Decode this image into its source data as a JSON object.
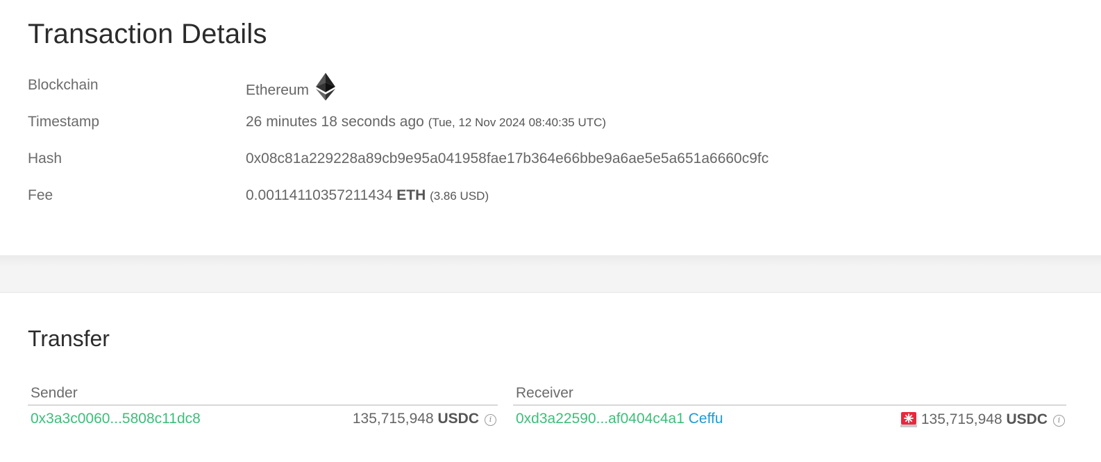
{
  "details": {
    "title": "Transaction Details",
    "rows": [
      {
        "label": "Blockchain",
        "value": "Ethereum"
      },
      {
        "label": "Timestamp",
        "value": "26 minutes 18 seconds ago",
        "note": "(Tue, 12 Nov 2024 08:40:35 UTC)"
      },
      {
        "label": "Hash",
        "value": "0x08c81a229228a89cb9e95a041958fae17b364e66bbe9a6ae5e5a651a6660c9fc"
      },
      {
        "label": "Fee",
        "value": "0.00114110357211434",
        "unit": "ETH",
        "note": "(3.86 USD)"
      }
    ],
    "blockchain_icon": "ethereum-icon"
  },
  "transfer": {
    "title": "Transfer",
    "sender": {
      "header": "Sender",
      "address": "0x3a3c0060...5808c11dc8",
      "amount": "135,715,948",
      "unit": "USDC"
    },
    "receiver": {
      "header": "Receiver",
      "address": "0xd3a22590...af0404c4a1",
      "tag": "Ceffu",
      "amount": "135,715,948",
      "unit": "USDC",
      "alert_icon": "siren-alert-icon"
    }
  },
  "colors": {
    "link_green": "#3dbe7a",
    "tag_blue": "#1a9bd7",
    "alert_red": "#e8283c"
  }
}
